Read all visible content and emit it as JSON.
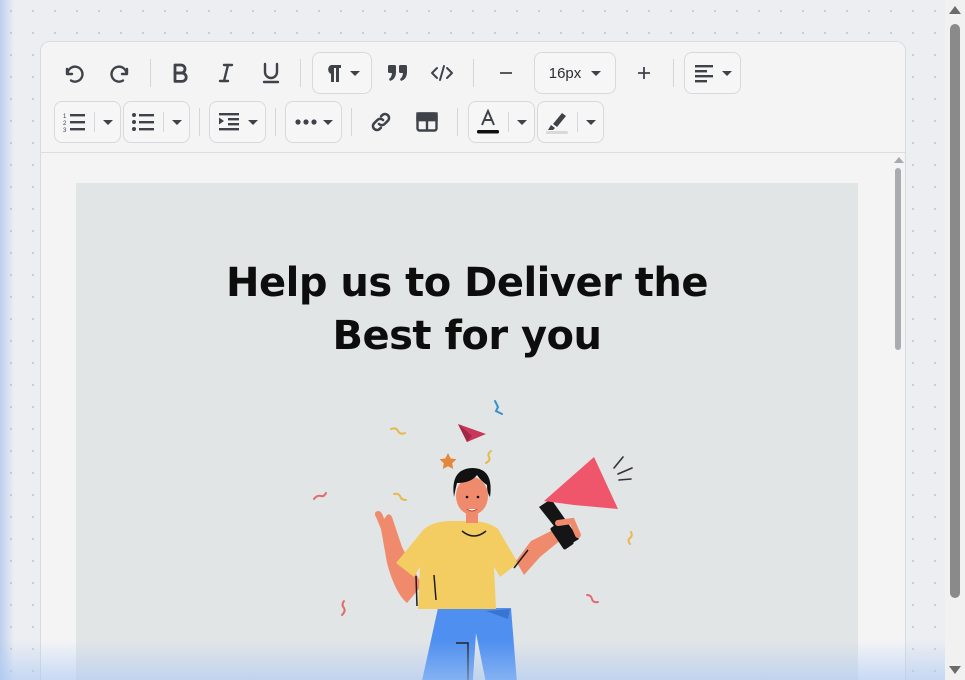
{
  "toolbar": {
    "font_size": "16px",
    "row1": [
      "undo-icon",
      "redo-icon",
      "bold-icon",
      "italic-icon",
      "underline-icon",
      "paragraph-icon",
      "blockquote-icon",
      "code-icon",
      "minus-icon",
      "font-size",
      "plus-icon",
      "align-left-icon"
    ],
    "row2": [
      "ordered-list-icon",
      "bullet-list-icon",
      "indent-icon",
      "more-icon",
      "link-icon",
      "table-icon",
      "text-color-icon",
      "highlight-icon"
    ],
    "text_color": "#111111",
    "highlight_color": "#d9d9d9"
  },
  "content": {
    "headline_line1": "Help us to Deliver the",
    "headline_line2": "Best for you"
  },
  "colors": {
    "canvas_bg": "#e2e5e6",
    "shirt": "#f3cd62",
    "pants": "#4e8ff0",
    "skin": "#f08a6c",
    "megaphone": "#f0566b"
  }
}
